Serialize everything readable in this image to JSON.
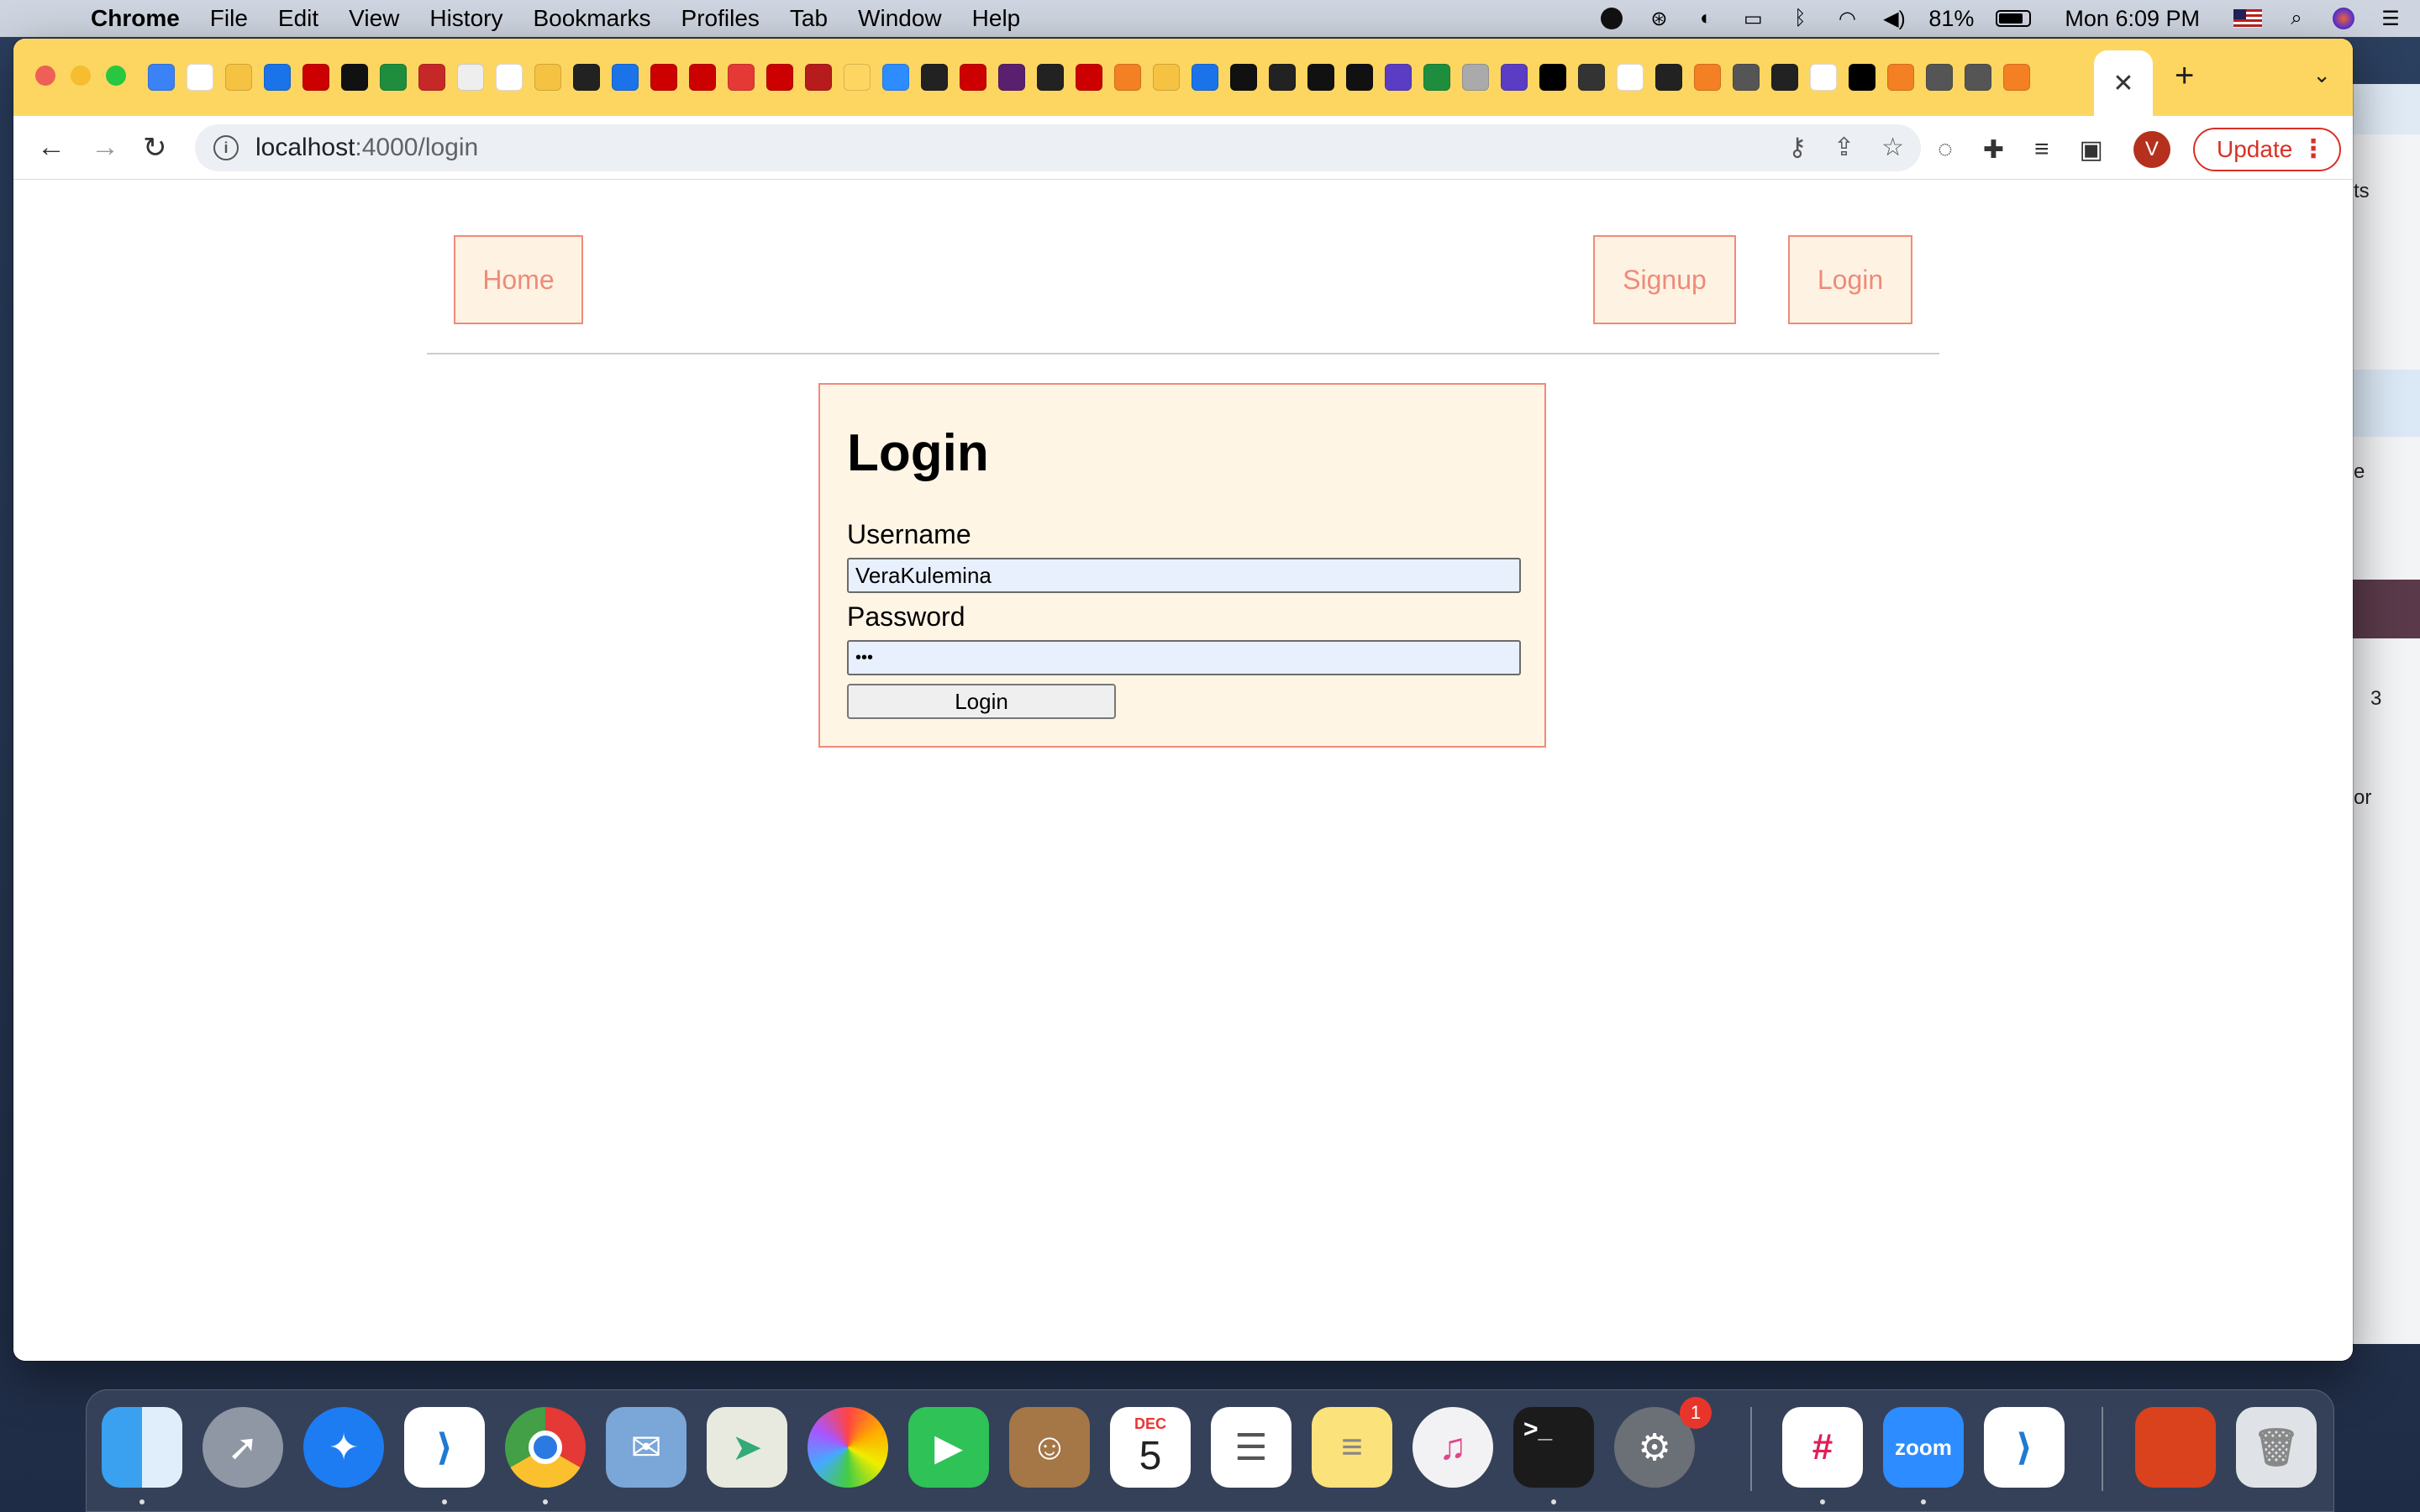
{
  "menubar": {
    "app": "Chrome",
    "items": [
      "File",
      "Edit",
      "View",
      "History",
      "Bookmarks",
      "Profiles",
      "Tab",
      "Window",
      "Help"
    ],
    "battery_percent": "81%",
    "battery_level": 0.81,
    "clock": "Mon 6:09 PM"
  },
  "browser": {
    "url_host": "localhost",
    "url_path": ":4000/login",
    "update_label": "Update",
    "profile_initial": "V",
    "tab_close": "✕",
    "new_tab": "+"
  },
  "behind_window": {
    "text1": "ts",
    "text2": "e",
    "count": "3",
    "text3": "or"
  },
  "nav": {
    "home": "Home",
    "signup": "Signup",
    "login": "Login"
  },
  "form": {
    "title": "Login",
    "username_label": "Username",
    "username_value": "VeraKulemina",
    "password_label": "Password",
    "password_value": "•••",
    "submit_label": "Login"
  },
  "dock": {
    "calendar_month": "DEC",
    "calendar_day": "5",
    "settings_badge": "1",
    "zoom_label": "zoom"
  },
  "colors": {
    "tabstrip": "#fcd660",
    "accent": "#f08a7a",
    "card_bg": "#fef5e5",
    "update_red": "#d93025"
  }
}
